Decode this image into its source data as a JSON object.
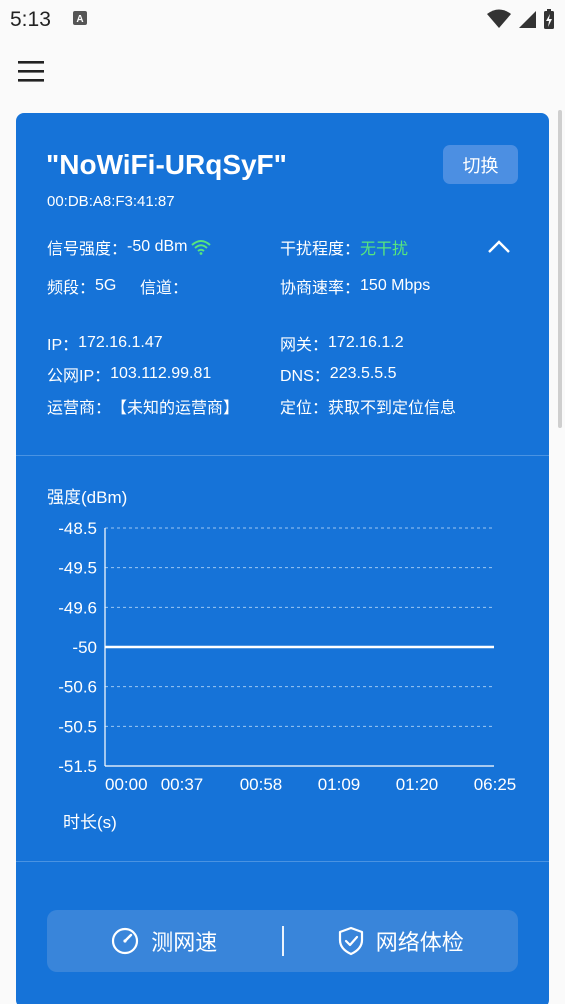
{
  "status_bar": {
    "time": "5:13",
    "icons": [
      "text-notification-icon",
      "wifi-icon",
      "cellular-signal-icon",
      "battery-charging-icon"
    ]
  },
  "menu": {
    "icon": "hamburger-menu-icon"
  },
  "wifi": {
    "ssid": "\"NoWiFi-URqSyF\"",
    "mac": "00:DB:A8:F3:41:87",
    "switch_label": "切换"
  },
  "details": {
    "signal_label": "信号强度：",
    "signal_value": "-50 dBm",
    "interference_label": "干扰程度：",
    "interference_value": "无干扰",
    "band_label": "频段：",
    "band_value": "5G",
    "channel_label": "信道：",
    "channel_value": "",
    "link_speed_label": "协商速率：",
    "link_speed_value": "150 Mbps",
    "ip_label": "IP：",
    "ip_value": "172.16.1.47",
    "gateway_label": "网关：",
    "gateway_value": "172.16.1.2",
    "public_ip_label": "公网IP：",
    "public_ip_value": "103.112.99.81",
    "dns_label": "DNS：",
    "dns_value": "223.5.5.5",
    "carrier_label": "运营商：",
    "carrier_value": "【未知的运营商】",
    "location_label": "定位：",
    "location_value": "获取不到定位信息"
  },
  "chart_data": {
    "type": "line",
    "ylabel": "强度(dBm)",
    "xlabel": "时长(s)",
    "y_tick_labels": [
      "-48.5",
      "-49.5",
      "-49.6",
      "-50",
      "-50.6",
      "-50.5",
      "-51.5"
    ],
    "x_tick_labels": [
      "00:00",
      "00:37",
      "00:58",
      "01:09",
      "01:20",
      "06:25"
    ],
    "series": [
      {
        "values": [
          -50,
          -50,
          -50,
          -50,
          -50,
          -50
        ]
      }
    ],
    "colors": {
      "line": "#ffffff",
      "grid": "#9cc6f2",
      "axis": "#ffffff"
    }
  },
  "actions": {
    "speed_test_label": "测网速",
    "network_check_label": "网络体检"
  },
  "colors": {
    "card": "#1673d8",
    "accent_good": "#57e67d",
    "background": "#fafafa"
  }
}
